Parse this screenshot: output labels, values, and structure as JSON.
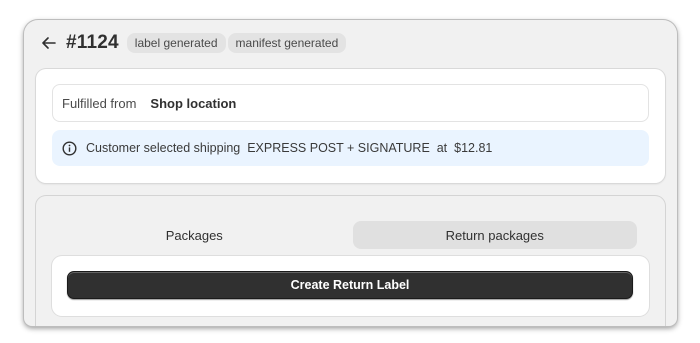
{
  "order": {
    "back_icon": "arrow-left-icon",
    "title": "#1124",
    "badges": [
      "label generated",
      "manifest generated"
    ]
  },
  "fulfillment": {
    "label": "Fulfilled from",
    "location": "Shop location"
  },
  "shipping_info": {
    "icon": "info-icon",
    "prefix": "Customer selected shipping",
    "method": "EXPRESS POST + SIGNATURE",
    "connector": "at",
    "price": "$12.81"
  },
  "tabs": [
    {
      "label": "Packages",
      "selected": false
    },
    {
      "label": "Return packages",
      "selected": true
    }
  ],
  "actions": {
    "create_return_label": "Create Return Label"
  },
  "colors": {
    "frame_bg": "#f1f1f1",
    "info_bg": "#eaf4ff",
    "primary_button": "#303030",
    "badge_bg": "#e3e3e3"
  }
}
